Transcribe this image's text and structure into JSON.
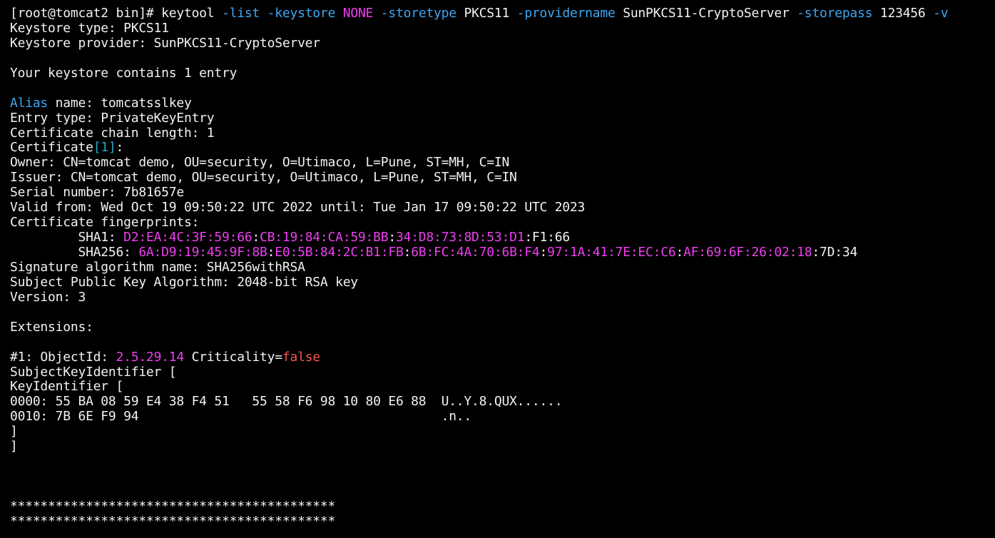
{
  "colors": {
    "background": "#000000",
    "default": "#f2f2f2",
    "option": "#3fa7f0",
    "magenta": "#ee3ef0",
    "cyan": "#2aa7c8",
    "red": "#f0584a"
  },
  "lines": [
    [
      {
        "t": "[root@tomcat2 bin]# keytool ",
        "c": "default"
      },
      {
        "t": "-list",
        "c": "option"
      },
      {
        "t": " ",
        "c": "default"
      },
      {
        "t": "-keystore",
        "c": "option"
      },
      {
        "t": " ",
        "c": "default"
      },
      {
        "t": "NONE",
        "c": "magenta"
      },
      {
        "t": " ",
        "c": "default"
      },
      {
        "t": "-storetype",
        "c": "option"
      },
      {
        "t": " PKCS11 ",
        "c": "default"
      },
      {
        "t": "-providername",
        "c": "option"
      },
      {
        "t": " SunPKCS11-CryptoServer ",
        "c": "default"
      },
      {
        "t": "-storepass",
        "c": "option"
      },
      {
        "t": " 123456 ",
        "c": "default"
      },
      {
        "t": "-v",
        "c": "option"
      }
    ],
    [
      {
        "t": "Keystore type: PKCS11",
        "c": "default"
      }
    ],
    [
      {
        "t": "Keystore provider: SunPKCS11-CryptoServer",
        "c": "default"
      }
    ],
    [],
    [
      {
        "t": "Your keystore contains 1 entry",
        "c": "default"
      }
    ],
    [],
    [
      {
        "t": "Alias",
        "c": "option"
      },
      {
        "t": " name: tomcatsslkey",
        "c": "default"
      }
    ],
    [
      {
        "t": "Entry type: PrivateKeyEntry",
        "c": "default"
      }
    ],
    [
      {
        "t": "Certificate chain length: 1",
        "c": "default"
      }
    ],
    [
      {
        "t": "Certificate",
        "c": "default"
      },
      {
        "t": "[1]",
        "c": "cyan"
      },
      {
        "t": ":",
        "c": "default"
      }
    ],
    [
      {
        "t": "Owner: CN=tomcat demo, OU=security, O=Utimaco, L=Pune, ST=MH, C=IN",
        "c": "default"
      }
    ],
    [
      {
        "t": "Issuer: CN=tomcat demo, OU=security, O=Utimaco, L=Pune, ST=MH, C=IN",
        "c": "default"
      }
    ],
    [
      {
        "t": "Serial number: 7b81657e",
        "c": "default"
      }
    ],
    [
      {
        "t": "Valid from: Wed Oct 19 09:50:22 UTC 2022 until: Tue Jan 17 09:50:22 UTC 2023",
        "c": "default"
      }
    ],
    [
      {
        "t": "Certificate fingerprints:",
        "c": "default"
      }
    ],
    [
      {
        "t": "         SHA1: ",
        "c": "default"
      },
      {
        "t": "D2:EA:4C:3F:59:66",
        "c": "magenta"
      },
      {
        "t": ":",
        "c": "default"
      },
      {
        "t": "CB:19:84:CA:59:BB",
        "c": "magenta"
      },
      {
        "t": ":",
        "c": "default"
      },
      {
        "t": "34:D8:73:8D:53:D1",
        "c": "magenta"
      },
      {
        "t": ":F1:66",
        "c": "default"
      }
    ],
    [
      {
        "t": "         SHA256: ",
        "c": "default"
      },
      {
        "t": "6A:D9:19:45:9F:8B",
        "c": "magenta"
      },
      {
        "t": ":",
        "c": "default"
      },
      {
        "t": "E0:5B:84:2C:B1:FB",
        "c": "magenta"
      },
      {
        "t": ":",
        "c": "default"
      },
      {
        "t": "6B:FC:4A:70:6B:F4",
        "c": "magenta"
      },
      {
        "t": ":",
        "c": "default"
      },
      {
        "t": "97:1A:41:7E:EC:C6",
        "c": "magenta"
      },
      {
        "t": ":",
        "c": "default"
      },
      {
        "t": "AF:69:6F:26:02:18",
        "c": "magenta"
      },
      {
        "t": ":7D:34",
        "c": "default"
      }
    ],
    [
      {
        "t": "Signature algorithm name: SHA256withRSA",
        "c": "default"
      }
    ],
    [
      {
        "t": "Subject Public Key Algorithm: 2048-bit RSA key",
        "c": "default"
      }
    ],
    [
      {
        "t": "Version: 3",
        "c": "default"
      }
    ],
    [],
    [
      {
        "t": "Extensions:",
        "c": "default"
      }
    ],
    [],
    [
      {
        "t": "#1: ObjectId: ",
        "c": "default"
      },
      {
        "t": "2.5.29.14",
        "c": "magenta"
      },
      {
        "t": " Criticality=",
        "c": "default"
      },
      {
        "t": "false",
        "c": "red"
      }
    ],
    [
      {
        "t": "SubjectKeyIdentifier [",
        "c": "default"
      }
    ],
    [
      {
        "t": "KeyIdentifier [",
        "c": "default"
      }
    ],
    [
      {
        "t": "0000: 55 BA 08 59 E4 38 F4 51   55 58 F6 98 10 80 E6 88  U..Y.8.QUX......",
        "c": "default"
      }
    ],
    [
      {
        "t": "0010: 7B 6E F9 94                                        .n..",
        "c": "default"
      }
    ],
    [
      {
        "t": "]",
        "c": "default"
      }
    ],
    [
      {
        "t": "]",
        "c": "default"
      }
    ],
    [],
    [],
    [],
    [
      {
        "t": "*******************************************",
        "c": "default"
      }
    ],
    [
      {
        "t": "*******************************************",
        "c": "default"
      }
    ]
  ]
}
